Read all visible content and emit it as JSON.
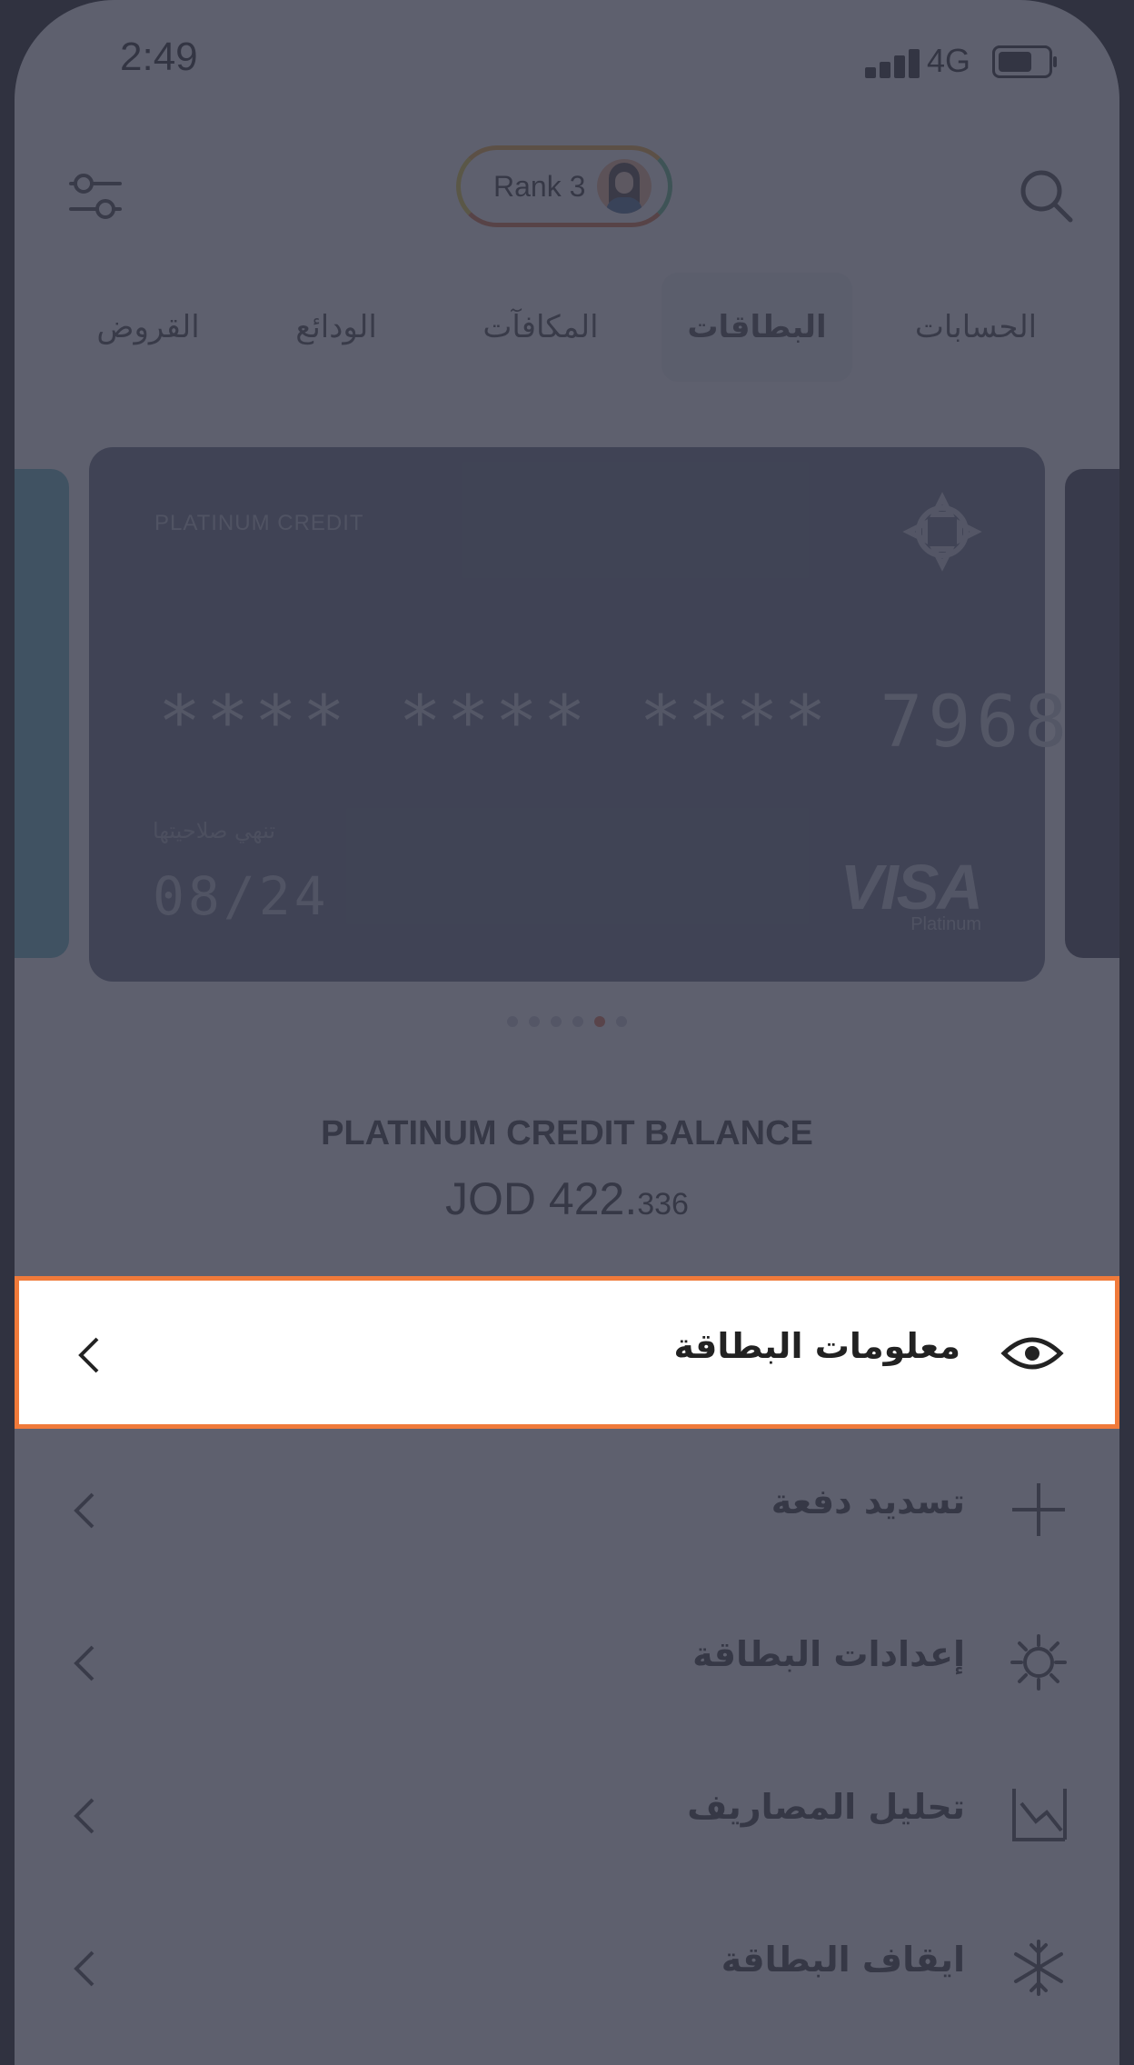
{
  "status": {
    "time": "2:49",
    "network": "4G"
  },
  "header": {
    "rank_label": "Rank 3"
  },
  "tabs": [
    {
      "label": "الحسابات",
      "active": false
    },
    {
      "label": "البطاقات",
      "active": true
    },
    {
      "label": "المكافآت",
      "active": false
    },
    {
      "label": "الودائع",
      "active": false
    },
    {
      "label": "القروض",
      "active": false
    }
  ],
  "card": {
    "type": "PLATINUM CREDIT",
    "number": "****  ****  ****  7968",
    "expiry_label": "تنهي صلاحيتها",
    "expiry": "08/24",
    "brand": "VISA",
    "brand_sub": "Platinum",
    "page_index": 4,
    "page_count": 6
  },
  "balance": {
    "title": "PLATINUM CREDIT BALANCE",
    "amount_main": "JOD 422.",
    "amount_decimals": "336"
  },
  "menu": {
    "card_info": {
      "label": "معلومات البطاقة",
      "icon": "eye-icon"
    },
    "pay": {
      "label": "تسديد دفعة",
      "icon": "plus-icon"
    },
    "settings": {
      "label": "إعدادات البطاقة",
      "icon": "gear-icon"
    },
    "analysis": {
      "label": "تحليل المصاريف",
      "icon": "chart-icon"
    },
    "freeze": {
      "label": "ايقاف البطاقة",
      "icon": "snowflake-icon"
    }
  },
  "colors": {
    "highlight_border": "#f07a3a",
    "overlay": "#3a3d4e",
    "card_bg": "#5c6275"
  }
}
